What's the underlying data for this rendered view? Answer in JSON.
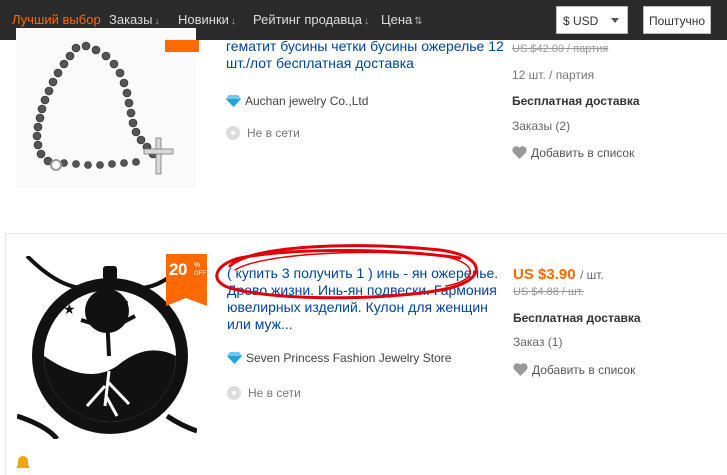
{
  "sort_bar": {
    "items": [
      {
        "label": "Лучший выбор",
        "active": true
      },
      {
        "label": "Заказы",
        "arrow": "↓"
      },
      {
        "label": "Новинки",
        "arrow": "↓"
      },
      {
        "label": "Рейтинг продавца",
        "arrow": "↓"
      },
      {
        "label": "Цена",
        "arrow": "⇅"
      }
    ],
    "currency": "$ USD",
    "per_piece_label": "Поштучно"
  },
  "products": [
    {
      "title": "гематит бусины четки бусины ожерелье 12 шт./лот бесплатная доставка",
      "store": "Auchan jewelry Co.,Ltd",
      "status": "Не в сети",
      "old_price": "US $42.00 / партия",
      "lot_info": "12 шт. / партия",
      "shipping": "Бесплатная доставка",
      "orders": "Заказы (2)",
      "wishlist": "Добавить в список"
    },
    {
      "badge": {
        "percent": "20",
        "percent_sign": "%",
        "off": "OFF"
      },
      "title": "( купить 3 получить 1 ) инь - ян ожерелье. Древо жизни. Инь-ян подвески. Гармония ювелирных изделий. Кулон для женщин или муж...",
      "store": "Seven Princess Fashion Jewelry Store",
      "status": "Не в сети",
      "price": "US $3.90",
      "price_unit": "/ шт.",
      "old_price": "US $4.88 / шт.",
      "shipping": "Бесплатная доставка",
      "orders": "Заказ (1)",
      "wishlist": "Добавить в список"
    }
  ],
  "colors": {
    "accent": "#ff6a00",
    "link": "#004499",
    "topbar": "#2b2b2b",
    "scribble": "#e0000a"
  }
}
